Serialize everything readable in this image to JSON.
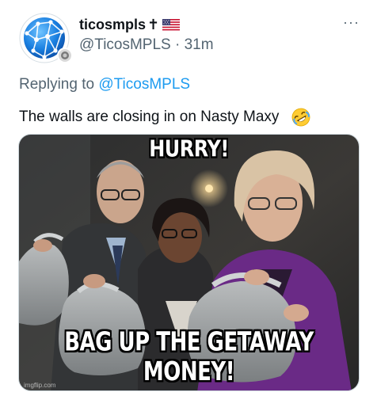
{
  "author": {
    "display_name": "ticosmpls",
    "name_symbol": "✝",
    "flag_icon": "us-flag-icon",
    "handle": "@TicosMPLS",
    "separator": "·",
    "time_ago": "31m",
    "avatar_icon": "globe-network-avatar",
    "badge_icon": "affiliate-badge-icon"
  },
  "menu": {
    "more_label": "···"
  },
  "reply": {
    "prefix": "Replying to",
    "mention": "@TicosMPLS"
  },
  "tweet": {
    "text": "The walls are closing in on Nasty Maxy",
    "emoji_icon": "rolling-on-floor-laughing-emoji"
  },
  "media": {
    "top_caption": "HURRY!",
    "bottom_caption": "BAG UP THE GETAWAY MONEY!",
    "watermark": "imgflip.com"
  },
  "colors": {
    "link": "#1d9bf0",
    "secondary_text": "#536471",
    "primary_text": "#0f1419",
    "jacket_purple": "#6a2a86"
  }
}
